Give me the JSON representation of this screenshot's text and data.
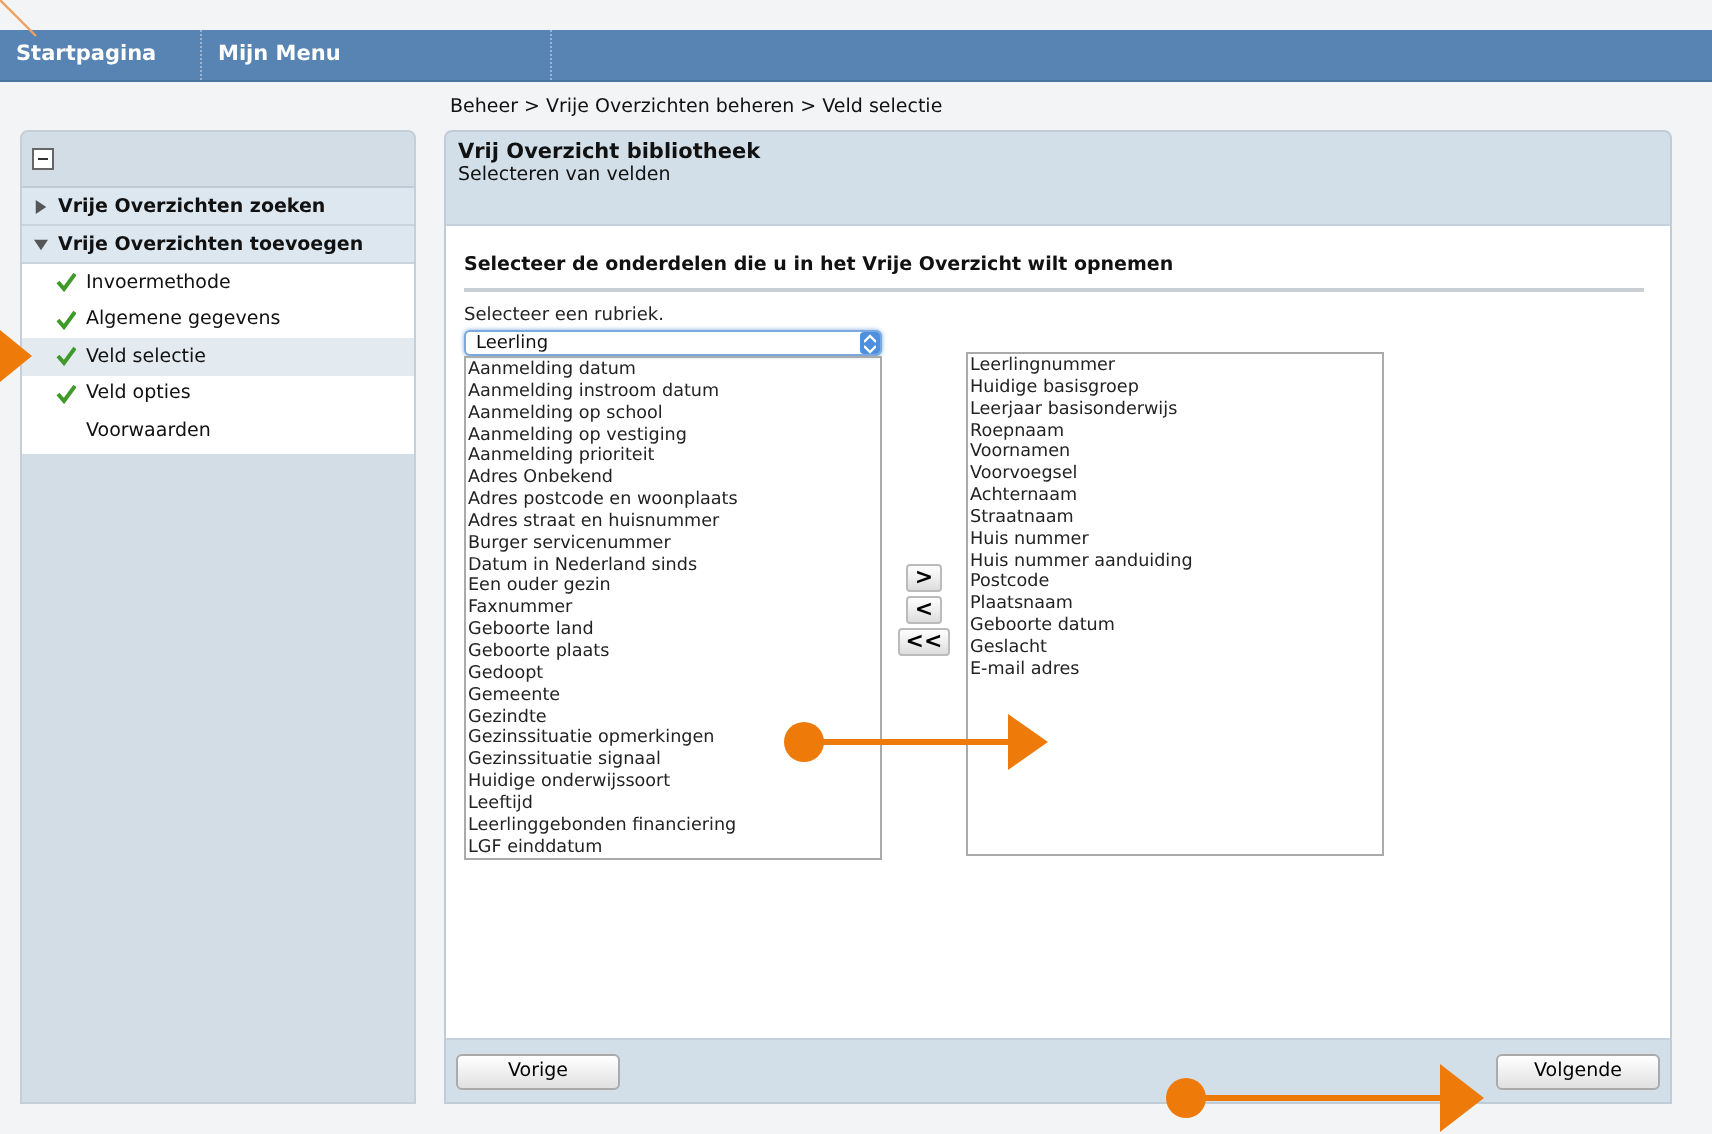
{
  "nav": [
    {
      "label": "Startpagina"
    },
    {
      "label": "Mijn Menu"
    }
  ],
  "breadcrumb": "Beheer > Vrije Overzichten beheren > Veld selectie",
  "sidebar": {
    "groups": [
      {
        "label": "Vrije Overzichten zoeken",
        "expanded": false
      },
      {
        "label": "Vrije Overzichten toevoegen",
        "expanded": true,
        "children": [
          {
            "label": "Invoermethode",
            "checked": true,
            "selected": false
          },
          {
            "label": "Algemene gegevens",
            "checked": true,
            "selected": false
          },
          {
            "label": "Veld selectie",
            "checked": true,
            "selected": true
          },
          {
            "label": "Veld opties",
            "checked": true,
            "selected": false
          },
          {
            "label": "Voorwaarden",
            "checked": false,
            "selected": false
          }
        ]
      }
    ]
  },
  "main": {
    "title": "Vrij Overzicht bibliotheek",
    "subtitle": "Selecteren van velden",
    "instruction": "Selecteer de onderdelen die u in het Vrije Overzicht wilt opnemen",
    "select_label": "Selecteer een rubriek.",
    "select_value": "Leerling",
    "available": [
      "Aanmelding datum",
      "Aanmelding instroom datum",
      "Aanmelding op school",
      "Aanmelding op vestiging",
      "Aanmelding prioriteit",
      "Adres Onbekend",
      "Adres postcode en woonplaats",
      "Adres straat en huisnummer",
      "Burger servicenummer",
      "Datum in Nederland sinds",
      "Een ouder gezin",
      "Faxnummer",
      "Geboorte land",
      "Geboorte plaats",
      "Gedoopt",
      "Gemeente",
      "Gezindte",
      "Gezinssituatie opmerkingen",
      "Gezinssituatie signaal",
      "Huidige onderwijssoort",
      "Leeftijd",
      "Leerlinggebonden financiering",
      "LGF einddatum"
    ],
    "transfer_buttons": [
      ">",
      "<",
      "<<"
    ],
    "chosen": [
      "Leerlingnummer",
      "Huidige basisgroep",
      "Leerjaar basisonderwijs",
      "Roepnaam",
      "Voornamen",
      "Voorvoegsel",
      "Achternaam",
      "Straatnaam",
      "Huis nummer",
      "Huis nummer aanduiding",
      "Postcode",
      "Plaatsnaam",
      "Geboorte datum",
      "Geslacht",
      "E-mail adres"
    ],
    "back_button": "Vorige",
    "next_button": "Volgende"
  }
}
